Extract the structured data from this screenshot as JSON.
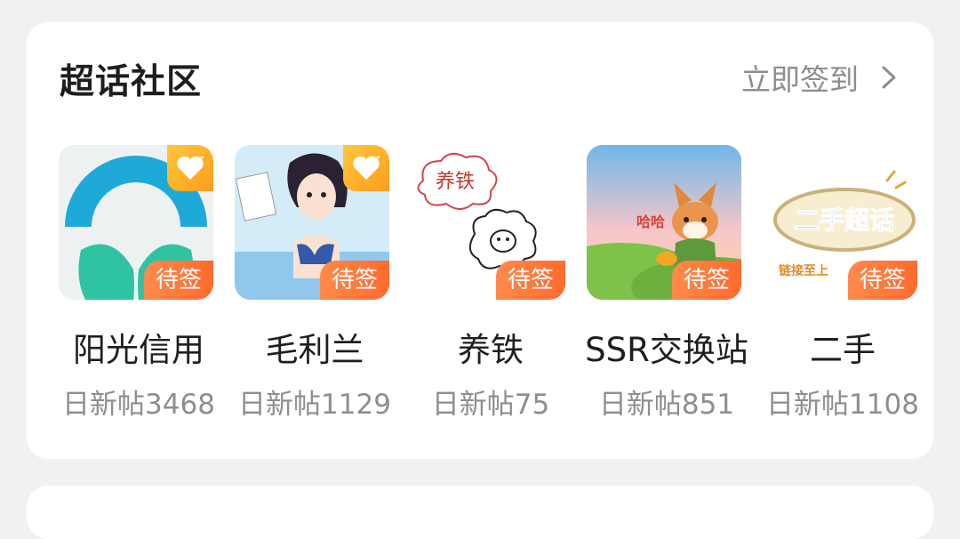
{
  "section": {
    "title": "超话社区",
    "checkin_label": "立即签到"
  },
  "communities": [
    {
      "name": "阳光信用",
      "daily_posts": "日新帖3468",
      "badge": "待签",
      "favorited": true,
      "thumb": "sunshine-credit-logo"
    },
    {
      "name": "毛利兰",
      "daily_posts": "日新帖1129",
      "badge": "待签",
      "favorited": true,
      "thumb": "anime-girl-illustration"
    },
    {
      "name": "养铁",
      "daily_posts": "日新帖75",
      "badge": "待签",
      "favorited": false,
      "thumb": "sheep-cloud-doodle",
      "thumb_text": "养铁"
    },
    {
      "name": "SSR交换站",
      "daily_posts": "日新帖851",
      "badge": "待签",
      "favorited": false,
      "thumb": "corgi-cartoon",
      "thumb_text": "哈哈"
    },
    {
      "name": "二手",
      "daily_posts": "日新帖1108",
      "badge": "待签",
      "favorited": false,
      "thumb": "secondhand-super-topic-logo",
      "thumb_text": "二手超话",
      "thumb_subtext": "链接至上"
    }
  ],
  "colors": {
    "badge": "#ff7a3c",
    "favorite": "#ffb02e",
    "muted_text": "#8e8e8e"
  }
}
